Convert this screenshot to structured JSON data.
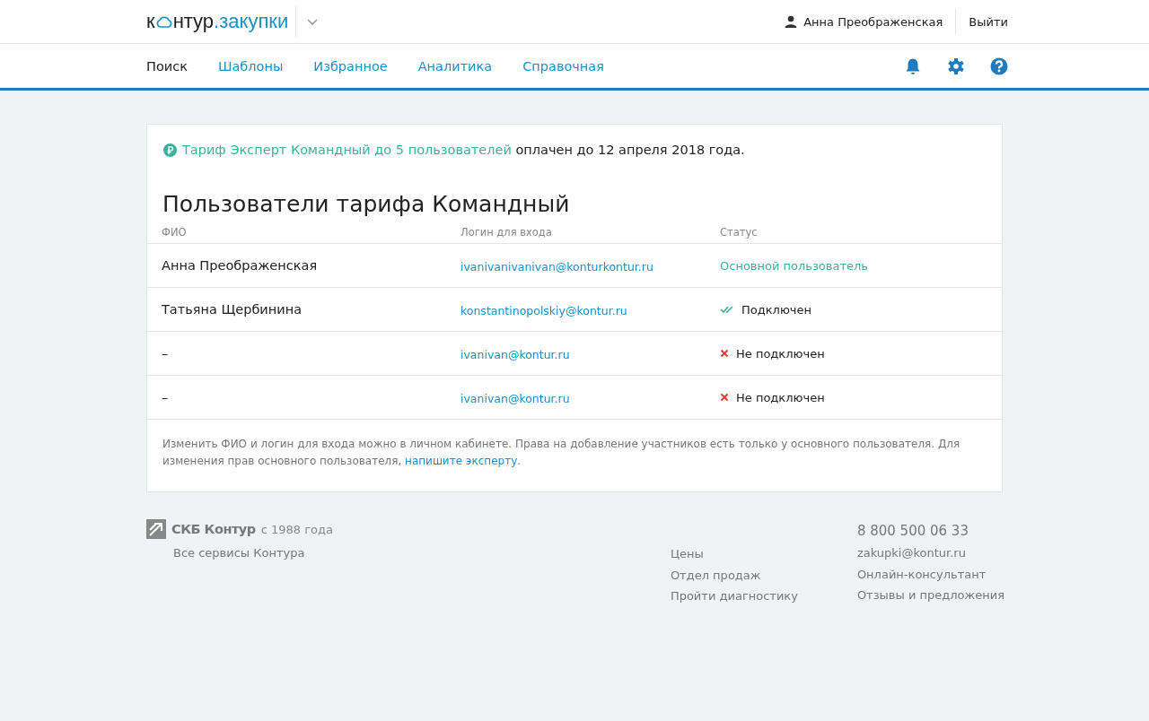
{
  "header": {
    "logo": {
      "prefix": "к",
      "suffix": "нтур",
      "product": ".закупки"
    },
    "user": "Анна Преображенская",
    "logout": "Выйти"
  },
  "nav": {
    "tabs": [
      {
        "label": "Поиск",
        "selected": true
      },
      {
        "label": "Шаблоны",
        "selected": false
      },
      {
        "label": "Избранное",
        "selected": false
      },
      {
        "label": "Аналитика",
        "selected": false
      },
      {
        "label": "Справочная",
        "selected": false
      }
    ]
  },
  "tariff_notice": {
    "link": "Тариф Эксперт Командный до 5 пользователей",
    "text": "оплачен до 12 апреля 2018 года."
  },
  "users": {
    "title": "Пользователи тарифа Командный",
    "columns": [
      "ФИО",
      "Логин для входа",
      "Статус"
    ],
    "rows": [
      {
        "name": "Анна Преображенская",
        "login": "ivanivanivanivan@konturkontur.ru",
        "status": {
          "kind": "primary",
          "label": "Основной пользователь"
        }
      },
      {
        "name": "Татьяна Щербинина",
        "login": "konstantinopolskiy@kontur.ru",
        "status": {
          "kind": "connected",
          "label": "Подключен"
        }
      },
      {
        "name": "–",
        "login": "ivanivan@kontur.ru",
        "status": {
          "kind": "not_connected",
          "label": "Не подключен"
        }
      },
      {
        "name": "–",
        "login": "ivanivan@kontur.ru",
        "status": {
          "kind": "not_connected",
          "label": "Не подключен"
        }
      }
    ],
    "note": {
      "text": "Изменить ФИО и логин для входа можно в личном кабинете. Права на добавление участников есть только у основного пользователя. Для изменения прав основного пользователя,",
      "link": "напишите эксперту",
      "end": "."
    }
  },
  "footer": {
    "brand": "СКБ Контур",
    "since": "с 1988 года",
    "all_services": "Все сервисы Контура",
    "links": [
      "Цены",
      "Отдел продаж",
      "Пройти диагностику"
    ],
    "phone": "8 800 500 06 33",
    "contacts": [
      "zakupki@kontur.ru",
      "Онлайн-консультант",
      "Отзывы и предложения"
    ]
  }
}
